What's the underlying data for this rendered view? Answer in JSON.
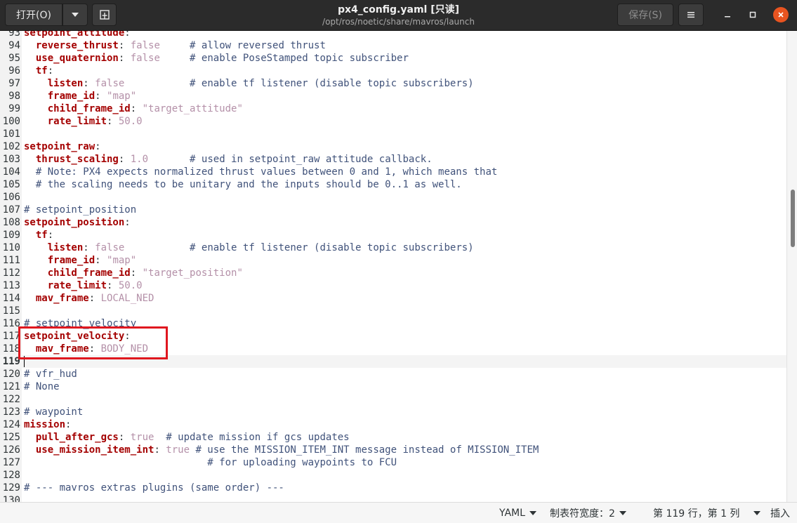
{
  "header": {
    "open_label": "打开(O)",
    "save_label": "保存(S)",
    "title": "px4_config.yaml [只读]",
    "subtitle": "/opt/ros/noetic/share/mavros/launch"
  },
  "editor": {
    "current_line": "119",
    "lines": [
      {
        "n": "93",
        "t": [
          [
            "k",
            "setpoint_attitude"
          ],
          [
            "p",
            ":"
          ]
        ]
      },
      {
        "n": "94",
        "t": [
          [
            "p",
            "  "
          ],
          [
            "k",
            "reverse_thrust"
          ],
          [
            "p",
            ": "
          ],
          [
            "v",
            "false"
          ],
          [
            "p",
            "     "
          ],
          [
            "c",
            "# allow reversed thrust"
          ]
        ]
      },
      {
        "n": "95",
        "t": [
          [
            "p",
            "  "
          ],
          [
            "k",
            "use_quaternion"
          ],
          [
            "p",
            ": "
          ],
          [
            "v",
            "false"
          ],
          [
            "p",
            "     "
          ],
          [
            "c",
            "# enable PoseStamped topic subscriber"
          ]
        ]
      },
      {
        "n": "96",
        "t": [
          [
            "p",
            "  "
          ],
          [
            "k",
            "tf"
          ],
          [
            "p",
            ":"
          ]
        ]
      },
      {
        "n": "97",
        "t": [
          [
            "p",
            "    "
          ],
          [
            "k",
            "listen"
          ],
          [
            "p",
            ": "
          ],
          [
            "v",
            "false"
          ],
          [
            "p",
            "           "
          ],
          [
            "c",
            "# enable tf listener (disable topic subscribers)"
          ]
        ]
      },
      {
        "n": "98",
        "t": [
          [
            "p",
            "    "
          ],
          [
            "k",
            "frame_id"
          ],
          [
            "p",
            ": "
          ],
          [
            "v",
            "\"map\""
          ]
        ]
      },
      {
        "n": "99",
        "t": [
          [
            "p",
            "    "
          ],
          [
            "k",
            "child_frame_id"
          ],
          [
            "p",
            ": "
          ],
          [
            "v",
            "\"target_attitude\""
          ]
        ]
      },
      {
        "n": "100",
        "t": [
          [
            "p",
            "    "
          ],
          [
            "k",
            "rate_limit"
          ],
          [
            "p",
            ": "
          ],
          [
            "v",
            "50.0"
          ]
        ]
      },
      {
        "n": "101",
        "t": []
      },
      {
        "n": "102",
        "t": [
          [
            "k",
            "setpoint_raw"
          ],
          [
            "p",
            ":"
          ]
        ]
      },
      {
        "n": "103",
        "t": [
          [
            "p",
            "  "
          ],
          [
            "k",
            "thrust_scaling"
          ],
          [
            "p",
            ": "
          ],
          [
            "v",
            "1.0"
          ],
          [
            "p",
            "       "
          ],
          [
            "c",
            "# used in setpoint_raw attitude callback."
          ]
        ]
      },
      {
        "n": "104",
        "t": [
          [
            "p",
            "  "
          ],
          [
            "c",
            "# Note: PX4 expects normalized thrust values between 0 and 1, which means that"
          ]
        ]
      },
      {
        "n": "105",
        "t": [
          [
            "p",
            "  "
          ],
          [
            "c",
            "# the scaling needs to be unitary and the inputs should be 0..1 as well."
          ]
        ]
      },
      {
        "n": "106",
        "t": []
      },
      {
        "n": "107",
        "t": [
          [
            "c",
            "# setpoint_position"
          ]
        ]
      },
      {
        "n": "108",
        "t": [
          [
            "k",
            "setpoint_position"
          ],
          [
            "p",
            ":"
          ]
        ]
      },
      {
        "n": "109",
        "t": [
          [
            "p",
            "  "
          ],
          [
            "k",
            "tf"
          ],
          [
            "p",
            ":"
          ]
        ]
      },
      {
        "n": "110",
        "t": [
          [
            "p",
            "    "
          ],
          [
            "k",
            "listen"
          ],
          [
            "p",
            ": "
          ],
          [
            "v",
            "false"
          ],
          [
            "p",
            "           "
          ],
          [
            "c",
            "# enable tf listener (disable topic subscribers)"
          ]
        ]
      },
      {
        "n": "111",
        "t": [
          [
            "p",
            "    "
          ],
          [
            "k",
            "frame_id"
          ],
          [
            "p",
            ": "
          ],
          [
            "v",
            "\"map\""
          ]
        ]
      },
      {
        "n": "112",
        "t": [
          [
            "p",
            "    "
          ],
          [
            "k",
            "child_frame_id"
          ],
          [
            "p",
            ": "
          ],
          [
            "v",
            "\"target_position\""
          ]
        ]
      },
      {
        "n": "113",
        "t": [
          [
            "p",
            "    "
          ],
          [
            "k",
            "rate_limit"
          ],
          [
            "p",
            ": "
          ],
          [
            "v",
            "50.0"
          ]
        ]
      },
      {
        "n": "114",
        "t": [
          [
            "p",
            "  "
          ],
          [
            "k",
            "mav_frame"
          ],
          [
            "p",
            ": "
          ],
          [
            "v",
            "LOCAL_NED"
          ]
        ]
      },
      {
        "n": "115",
        "t": []
      },
      {
        "n": "116",
        "t": [
          [
            "c",
            "# setpoint_velocity"
          ]
        ]
      },
      {
        "n": "117",
        "t": [
          [
            "k",
            "setpoint_velocity"
          ],
          [
            "p",
            ":"
          ]
        ]
      },
      {
        "n": "118",
        "t": [
          [
            "p",
            "  "
          ],
          [
            "k",
            "mav_frame"
          ],
          [
            "p",
            ": "
          ],
          [
            "v",
            "BODY_NED"
          ]
        ]
      },
      {
        "n": "119",
        "t": []
      },
      {
        "n": "120",
        "t": [
          [
            "c",
            "# vfr_hud"
          ]
        ]
      },
      {
        "n": "121",
        "t": [
          [
            "c",
            "# None"
          ]
        ]
      },
      {
        "n": "122",
        "t": []
      },
      {
        "n": "123",
        "t": [
          [
            "c",
            "# waypoint"
          ]
        ]
      },
      {
        "n": "124",
        "t": [
          [
            "k",
            "mission"
          ],
          [
            "p",
            ":"
          ]
        ]
      },
      {
        "n": "125",
        "t": [
          [
            "p",
            "  "
          ],
          [
            "k",
            "pull_after_gcs"
          ],
          [
            "p",
            ": "
          ],
          [
            "v",
            "true"
          ],
          [
            "p",
            "  "
          ],
          [
            "c",
            "# update mission if gcs updates"
          ]
        ]
      },
      {
        "n": "126",
        "t": [
          [
            "p",
            "  "
          ],
          [
            "k",
            "use_mission_item_int"
          ],
          [
            "p",
            ": "
          ],
          [
            "v",
            "true"
          ],
          [
            "p",
            " "
          ],
          [
            "c",
            "# use the MISSION_ITEM_INT message instead of MISSION_ITEM"
          ]
        ]
      },
      {
        "n": "127",
        "t": [
          [
            "p",
            "                               "
          ],
          [
            "c",
            "# for uploading waypoints to FCU"
          ]
        ]
      },
      {
        "n": "128",
        "t": []
      },
      {
        "n": "129",
        "t": [
          [
            "c",
            "# --- mavros extras plugins (same order) ---"
          ]
        ]
      },
      {
        "n": "130",
        "t": []
      }
    ]
  },
  "statusbar": {
    "language": "YAML",
    "tab_width": "制表符宽度：2",
    "position": "第 119 行，第 1 列",
    "mode": "插入"
  },
  "colors": {
    "key": "#a40000",
    "value": "#b490a8",
    "comment": "#40527a",
    "highlight_box": "#e0171f",
    "close_button": "#e95420"
  }
}
